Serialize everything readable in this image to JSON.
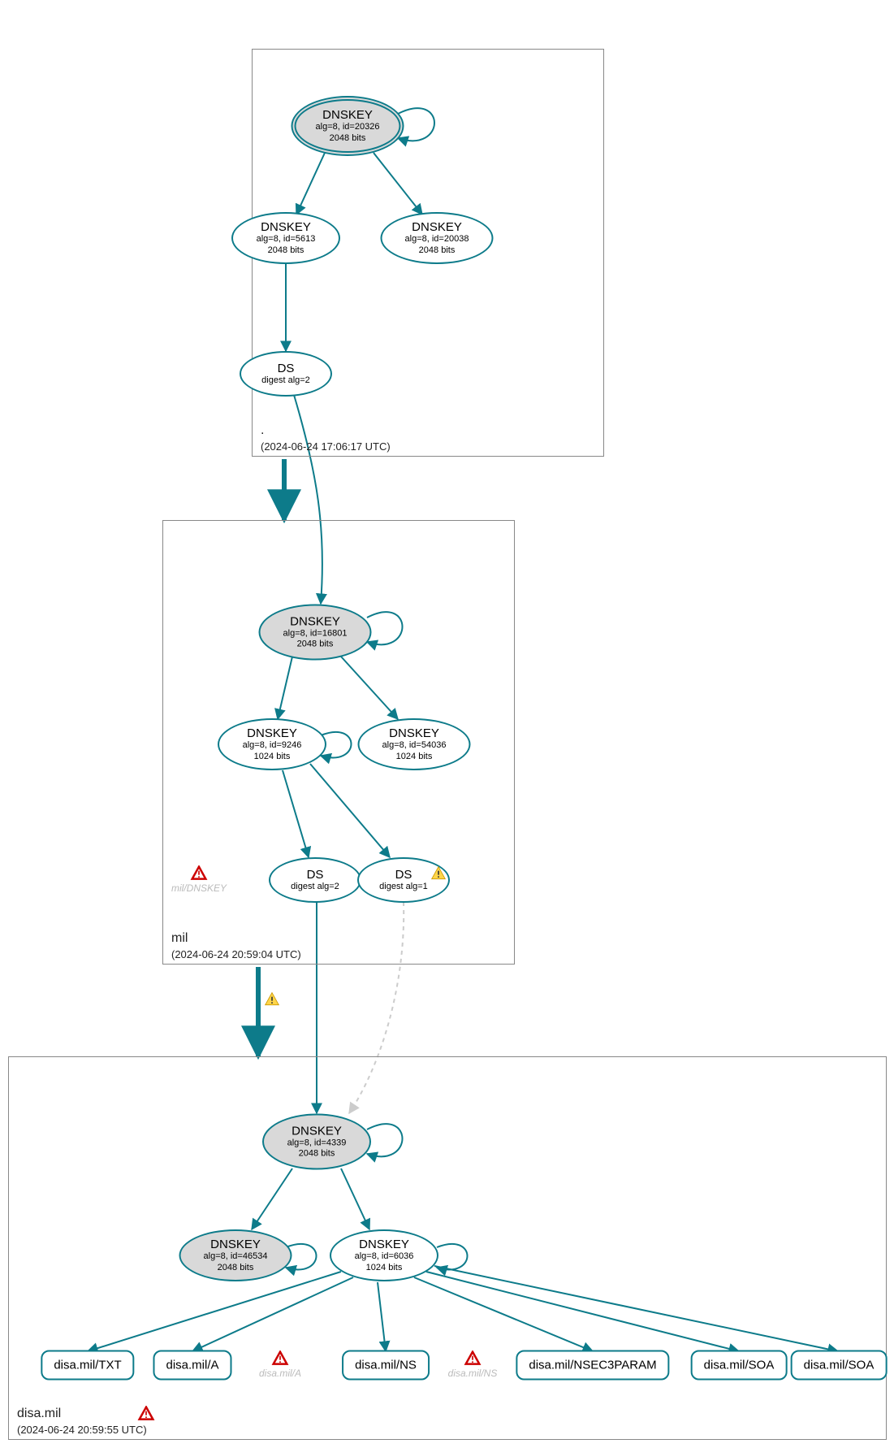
{
  "colors": {
    "stroke": "#0d7b8a",
    "fill_grey": "#d9d9d9"
  },
  "zones": {
    "root": {
      "name": ".",
      "timestamp": "(2024-06-24 17:06:17 UTC)"
    },
    "mil": {
      "name": "mil",
      "timestamp": "(2024-06-24 20:59:04 UTC)"
    },
    "disa": {
      "name": "disa.mil",
      "timestamp": "(2024-06-24 20:59:55 UTC)"
    }
  },
  "nodes": {
    "root_ksk": {
      "title": "DNSKEY",
      "l1": "alg=8, id=20326",
      "l2": "2048 bits"
    },
    "root_zsk1": {
      "title": "DNSKEY",
      "l1": "alg=8, id=5613",
      "l2": "2048 bits"
    },
    "root_zsk2": {
      "title": "DNSKEY",
      "l1": "alg=8, id=20038",
      "l2": "2048 bits"
    },
    "root_ds": {
      "title": "DS",
      "l1": "digest alg=2",
      "l2": ""
    },
    "mil_ksk": {
      "title": "DNSKEY",
      "l1": "alg=8, id=16801",
      "l2": "2048 bits"
    },
    "mil_zsk1": {
      "title": "DNSKEY",
      "l1": "alg=8, id=9246",
      "l2": "1024 bits"
    },
    "mil_zsk2": {
      "title": "DNSKEY",
      "l1": "alg=8, id=54036",
      "l2": "1024 bits"
    },
    "mil_ds1": {
      "title": "DS",
      "l1": "digest alg=2",
      "l2": ""
    },
    "mil_ds2": {
      "title": "DS",
      "l1": "digest alg=1",
      "l2": ""
    },
    "disa_ksk": {
      "title": "DNSKEY",
      "l1": "alg=8, id=4339",
      "l2": "2048 bits"
    },
    "disa_zsk1": {
      "title": "DNSKEY",
      "l1": "alg=8, id=46534",
      "l2": "2048 bits"
    },
    "disa_zsk2": {
      "title": "DNSKEY",
      "l1": "alg=8, id=6036",
      "l2": "1024 bits"
    }
  },
  "ghosts": {
    "mil_dnskey": "mil/DNSKEY",
    "disa_a": "disa.mil/A",
    "disa_ns": "disa.mil/NS"
  },
  "rr": {
    "txt": "disa.mil/TXT",
    "a": "disa.mil/A",
    "ns": "disa.mil/NS",
    "nsec3": "disa.mil/NSEC3PARAM",
    "soa1": "disa.mil/SOA",
    "soa2": "disa.mil/SOA"
  }
}
